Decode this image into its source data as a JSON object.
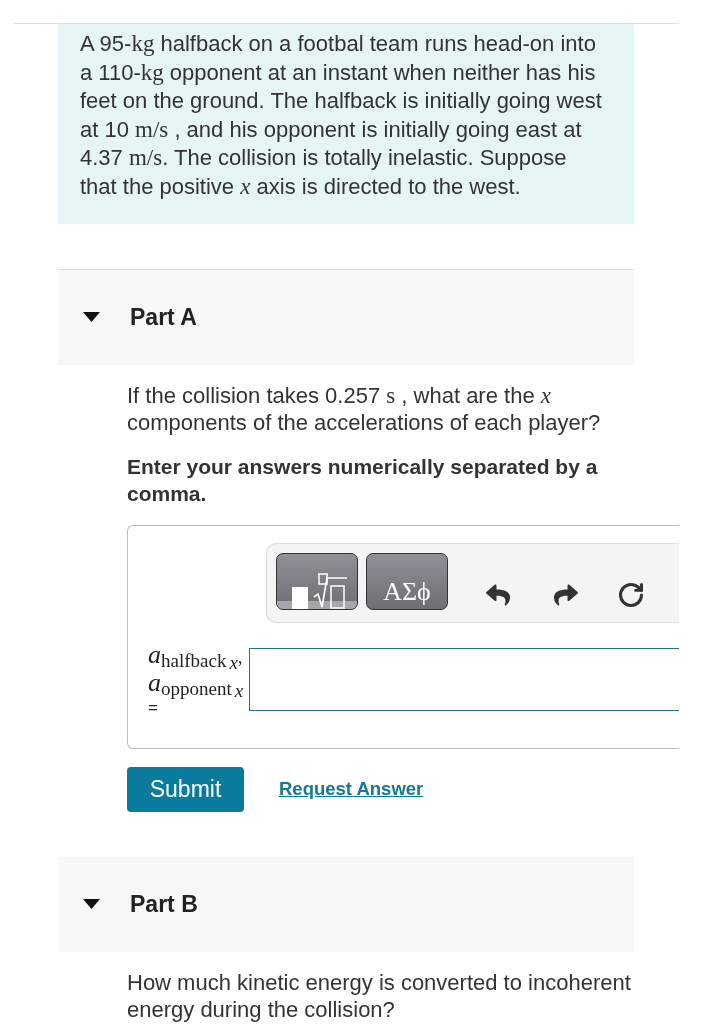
{
  "intro": {
    "segments": [
      {
        "kind": "text",
        "text": "A 95-"
      },
      {
        "kind": "unit",
        "text": "kg"
      },
      {
        "kind": "text",
        "text": " halfback on a footbal team runs head-on into a 110-"
      },
      {
        "kind": "unit",
        "text": "kg"
      },
      {
        "kind": "text",
        "text": " opponent at an instant when neither has his feet on the ground. The halfback is initially going west at 10 "
      },
      {
        "kind": "unit",
        "text": "m/s"
      },
      {
        "kind": "text",
        "text": " , and his opponent is initially going east at 4.37 "
      },
      {
        "kind": "unit",
        "text": "m/s"
      },
      {
        "kind": "text",
        "text": ". The collision is totally inelastic. Suppose that the positive "
      },
      {
        "kind": "variable",
        "text": "x"
      },
      {
        "kind": "text",
        "text": " axis is directed to the west."
      }
    ]
  },
  "parts": [
    {
      "title": "Part A",
      "expanded": true,
      "question": [
        {
          "kind": "text",
          "text": "If the collision takes 0.257 "
        },
        {
          "kind": "unit",
          "text": "s"
        },
        {
          "kind": "text",
          "text": " , what are the "
        },
        {
          "kind": "variable",
          "text": "x"
        },
        {
          "kind": "text",
          "text": " components of the accelerations of each player?"
        }
      ],
      "instruction": "Enter your answers numerically separated by a comma.",
      "answer": {
        "toolbar": [
          {
            "kind": "templates"
          },
          {
            "kind": "symbols",
            "label": "ΑΣϕ"
          },
          {
            "kind": "undo"
          },
          {
            "kind": "redo"
          },
          {
            "kind": "reset"
          }
        ],
        "variables": [
          {
            "symbol": "a",
            "subscript": "halfback",
            "index": "x",
            "separator": ","
          },
          {
            "symbol": "a",
            "subscript": "opponent",
            "index": "x"
          }
        ],
        "equals": "="
      },
      "buttons": [
        {
          "kind": "primary",
          "label": "Submit"
        },
        {
          "kind": "link",
          "label": "Request Answer"
        }
      ]
    },
    {
      "title": "Part B",
      "expanded": true,
      "question": [
        {
          "kind": "text",
          "text": "How much kinetic energy is converted to incoherent energy during the collision?"
        }
      ]
    }
  ]
}
